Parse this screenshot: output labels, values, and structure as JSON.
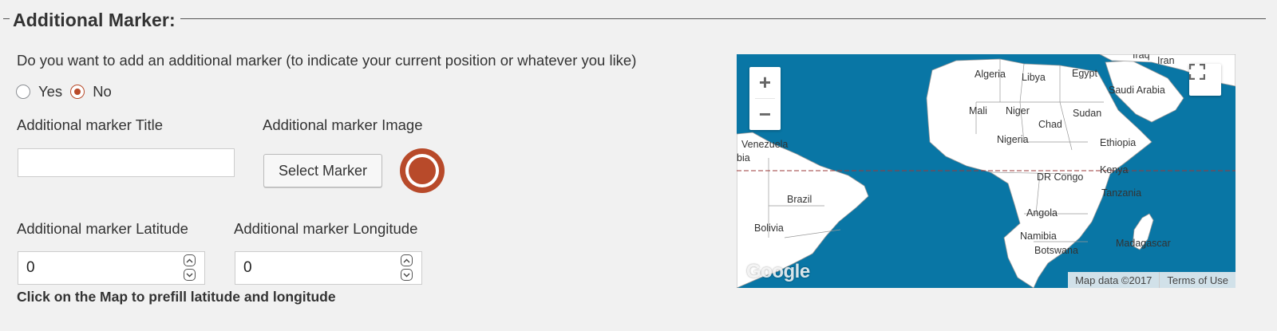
{
  "section": {
    "legend": "Additional Marker:"
  },
  "question": "Do you want to add an additional marker (to indicate your current position or whatever you like)",
  "radio": {
    "yes": "Yes",
    "no": "No",
    "selected": "No"
  },
  "fields": {
    "title_label": "Additional marker Title",
    "title_value": "",
    "image_label": "Additional marker Image",
    "select_button": "Select Marker",
    "latitude_label": "Additional marker Latitude",
    "latitude_value": "0",
    "longitude_label": "Additional marker Longitude",
    "longitude_value": "0"
  },
  "hint": "Click on the Map to prefill latitude and longitude",
  "map": {
    "zoom_in": "+",
    "zoom_out": "−",
    "logo": "Google",
    "map_data": "Map data ©2017",
    "terms": "Terms of Use",
    "labels": {
      "iraq": "Iraq",
      "iran": "Iran",
      "algeria": "Algeria",
      "libya": "Libya",
      "egypt": "Egypt",
      "saudi": "Saudi Arabia",
      "mali": "Mali",
      "niger": "Niger",
      "sudan": "Sudan",
      "chad": "Chad",
      "nigeria": "Nigeria",
      "ethiopia": "Ethiopia",
      "venezuela": "Venezuela",
      "bia": "bia",
      "kenya": "Kenya",
      "drc": "DR Congo",
      "brazil": "Brazil",
      "tanzania": "Tanzania",
      "angola": "Angola",
      "bolivia": "Bolivia",
      "namibia": "Namibia",
      "madagascar": "Madagascar",
      "botswana": "Botswana"
    }
  },
  "colors": {
    "accent": "#b84a2a",
    "ocean": "#0976a5",
    "land": "#ffffff"
  }
}
